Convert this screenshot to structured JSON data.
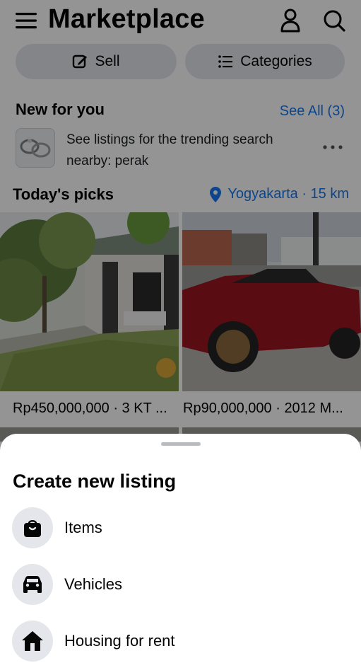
{
  "header": {
    "title": "Marketplace",
    "menu_icon": "hamburger-menu-icon",
    "profile_icon": "person-icon",
    "search_icon": "search-icon"
  },
  "actions": {
    "sell_label": "Sell",
    "categories_label": "Categories"
  },
  "new_for_you": {
    "heading": "New for you",
    "see_all": "See All (3)",
    "trending_text": "See listings for the trending search nearby: perak"
  },
  "todays_picks": {
    "heading": "Today's picks",
    "location": "Yogyakarta · 15 km",
    "listings": [
      {
        "price": "Rp450,000,000 · 3 KT ..."
      },
      {
        "price": "Rp90,000,000 · 2012 M..."
      }
    ]
  },
  "sheet": {
    "title": "Create new listing",
    "options": [
      {
        "label": "Items",
        "icon": "shopping-bag-icon"
      },
      {
        "label": "Vehicles",
        "icon": "car-icon"
      },
      {
        "label": "Housing for rent",
        "icon": "house-icon"
      }
    ]
  },
  "colors": {
    "accent": "#1877f2",
    "pill_bg": "#e4e6eb",
    "overlay": "rgba(0,0,0,0.42)"
  }
}
